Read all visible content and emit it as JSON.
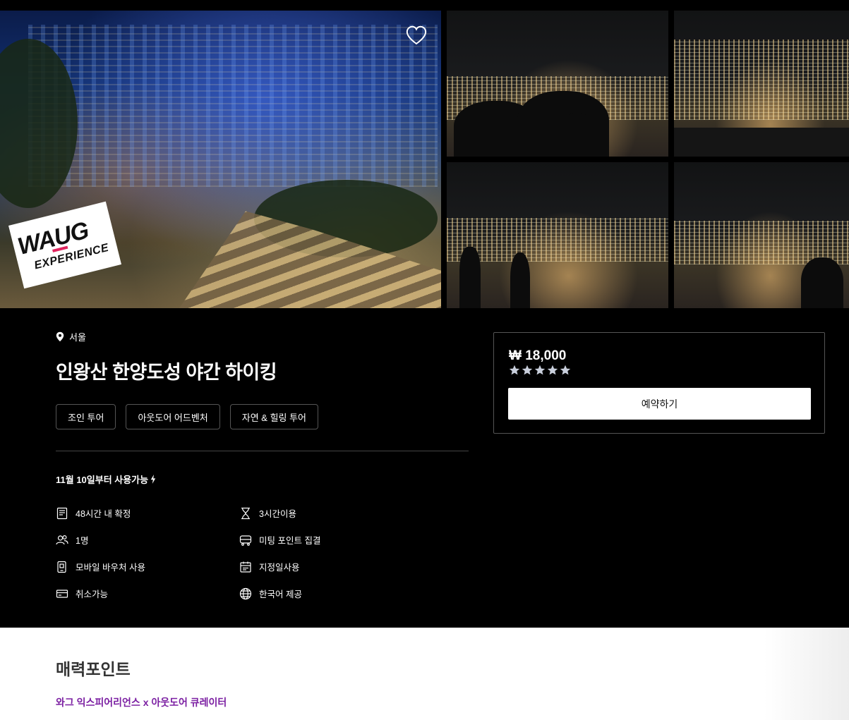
{
  "gallery": {
    "badge_top": "WAUG",
    "badge_bottom": "EXPERIENCE",
    "favorite_icon": "heart-icon"
  },
  "product": {
    "location": "서울",
    "location_icon": "map-pin-icon",
    "title": "인왕산 한양도성 야간 하이킹",
    "tags": [
      "조인 투어",
      "아웃도어 어드벤처",
      "자연 & 힐링 투어"
    ],
    "availability": "11월 10일부터 사용가능",
    "availability_icon": "lightning-icon",
    "features": [
      {
        "icon": "receipt-icon",
        "label": "48시간 내 확정"
      },
      {
        "icon": "hourglass-icon",
        "label": "3시간이용"
      },
      {
        "icon": "people-icon",
        "label": "1명"
      },
      {
        "icon": "bus-icon",
        "label": "미팅 포인트 집결"
      },
      {
        "icon": "mobile-voucher-icon",
        "label": "모바일 바우처 사용"
      },
      {
        "icon": "calendar-icon",
        "label": "지정일사용"
      },
      {
        "icon": "card-icon",
        "label": "취소가능"
      },
      {
        "icon": "globe-icon",
        "label": "한국어 제공"
      }
    ]
  },
  "booking": {
    "price": "₩ 18,000",
    "rating": 5,
    "book_label": "예약하기"
  },
  "highlights": {
    "title": "매력포인트",
    "subtitle": "와그 익스피어리언스 x 아웃도어 큐레이터"
  },
  "colors": {
    "background": "#000000",
    "accent": "#7b1fa2",
    "star": "#c9cfdc"
  }
}
